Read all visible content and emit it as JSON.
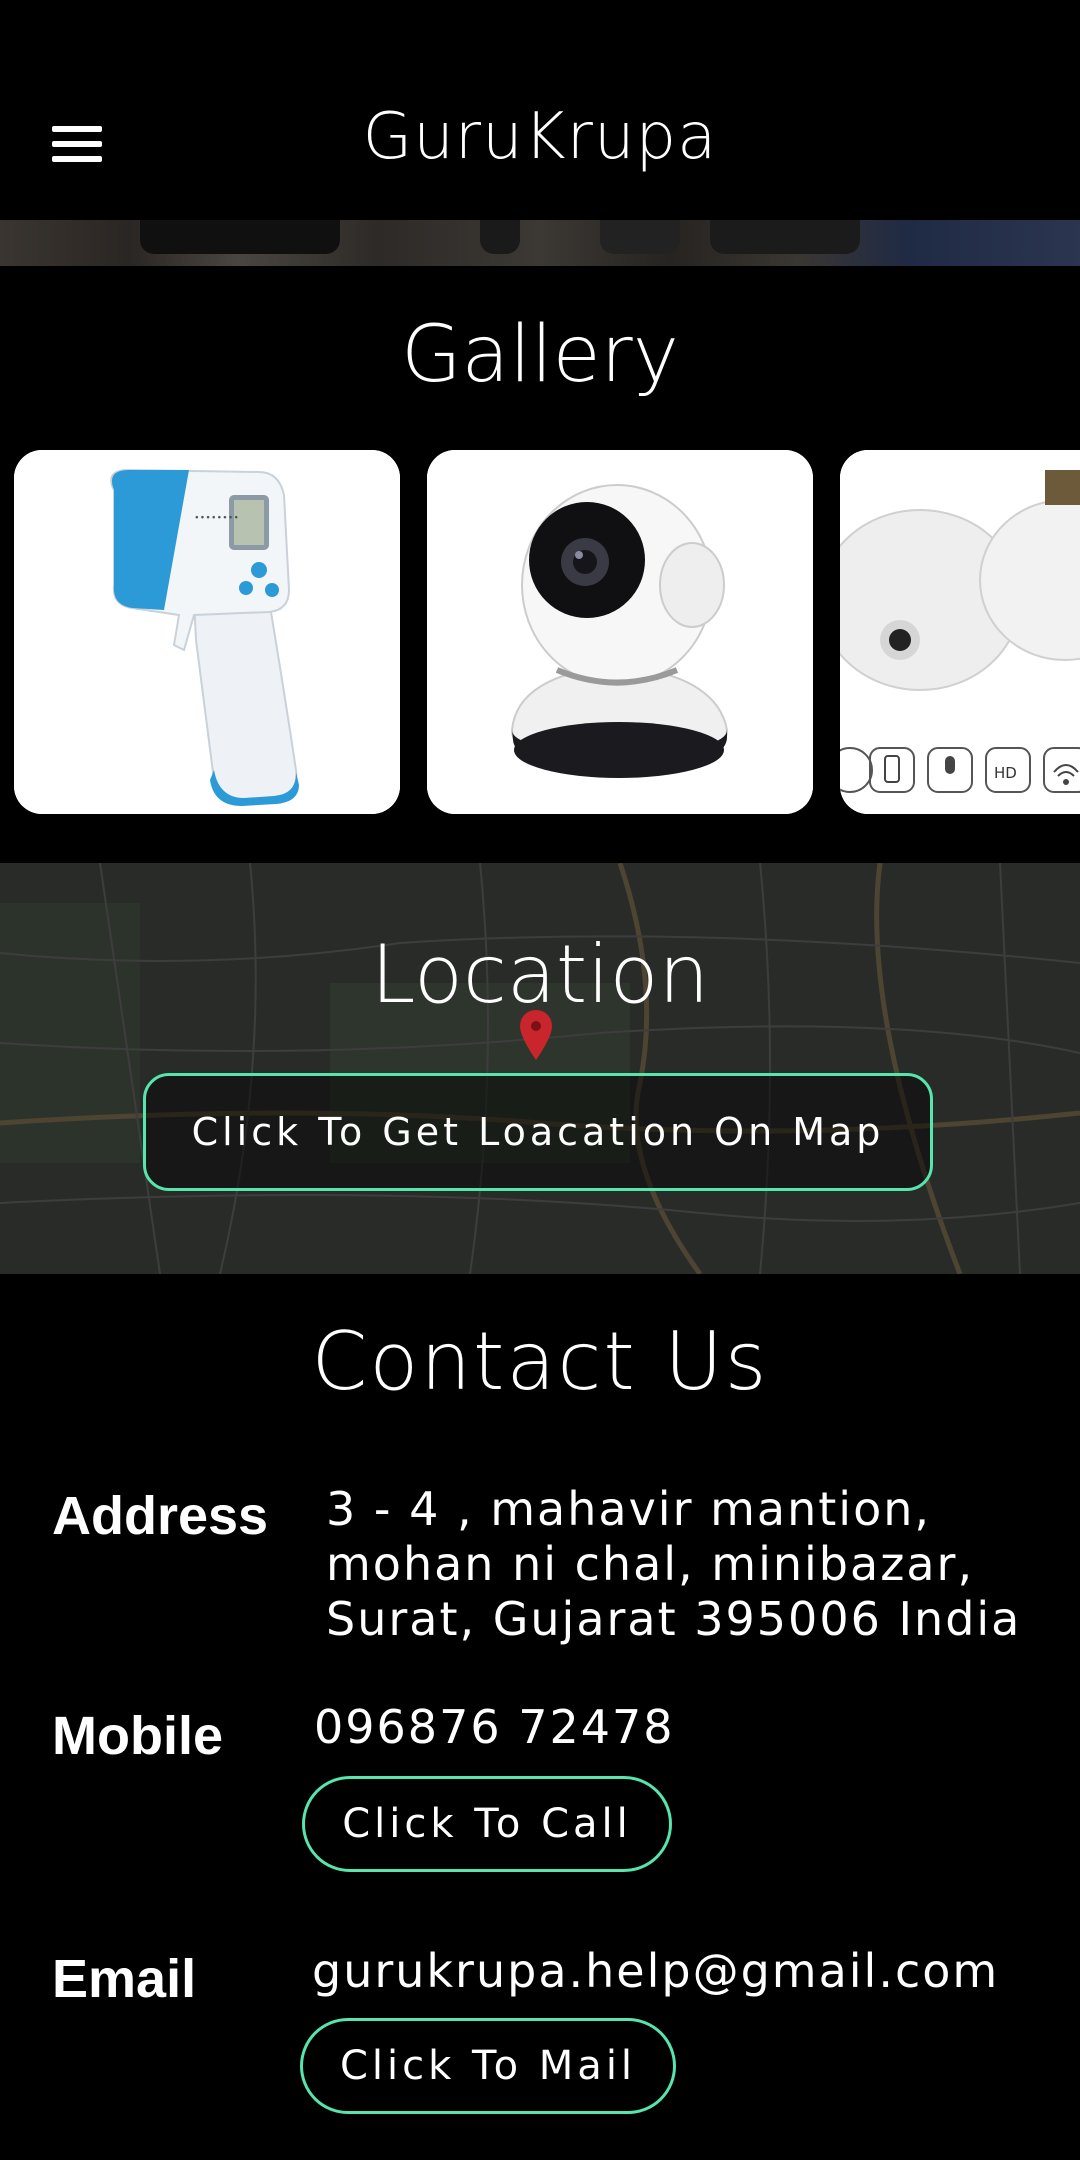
{
  "header": {
    "title": "GuruKrupa",
    "menu_icon": "hamburger-menu-icon"
  },
  "gallery": {
    "title": "Gallery",
    "items": [
      {
        "name": "infrared-thermometer"
      },
      {
        "name": "wifi-ip-camera"
      },
      {
        "name": "bulb-camera"
      }
    ],
    "bulb_icon_labels": [
      "HD"
    ]
  },
  "location": {
    "title": "Location",
    "button_label": "Click To Get Loacation On Map",
    "pin_icon": "map-pin-icon",
    "accent_color": "#56e5ad"
  },
  "contact": {
    "title": "Contact Us",
    "address_label": "Address",
    "address_lines": [
      "3 - 4 , mahavir mantion,",
      "mohan ni chal, minibazar,",
      "Surat, Gujarat 395006 India"
    ],
    "mobile_label": "Mobile",
    "mobile_value": "096876 72478",
    "call_button": "Click To Call",
    "email_label": "Email",
    "email_value": "gurukrupa.help@gmail.com",
    "mail_button": "Click To Mail"
  }
}
